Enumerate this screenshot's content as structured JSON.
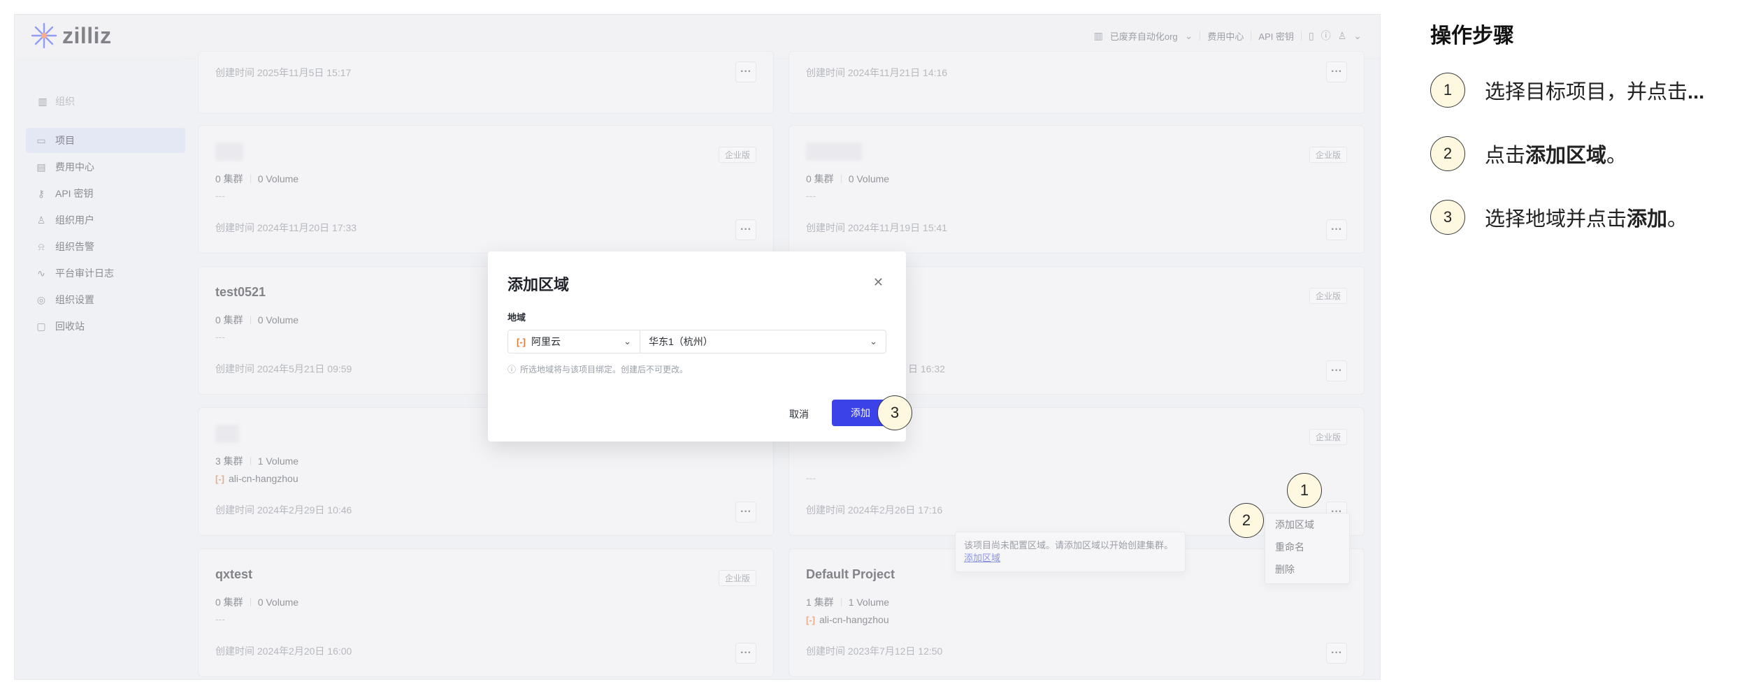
{
  "app": {
    "logo_text": "zilliz",
    "org_switcher": "已废弃自动化org",
    "billing_link": "费用中心",
    "api_key_link": "API 密钥"
  },
  "sidebar": {
    "org_label": "组织",
    "items": [
      {
        "label": "项目",
        "icon": "folder-icon",
        "active": true
      },
      {
        "label": "费用中心",
        "icon": "bill-icon"
      },
      {
        "label": "API 密钥",
        "icon": "key-icon"
      },
      {
        "label": "组织用户",
        "icon": "users-icon"
      },
      {
        "label": "组织告警",
        "icon": "alarm-icon"
      },
      {
        "label": "平台审计日志",
        "icon": "activity-icon"
      },
      {
        "label": "组织设置",
        "icon": "settings-icon"
      },
      {
        "label": "回收站",
        "icon": "trash-icon"
      }
    ]
  },
  "projects": {
    "tier_label": "企业版",
    "cards": [
      {
        "created": "创建时间 2025年11月5日 15:17"
      },
      {
        "created": "创建时间 2024年11月21日 14:16"
      },
      {
        "clusters": "0 集群",
        "volumes": "0 Volume",
        "region": "---",
        "created": "创建时间 2024年11月20日 17:33"
      },
      {
        "clusters": "0 集群",
        "volumes": "0 Volume",
        "region": "---",
        "created": "创建时间 2024年11月19日 15:41"
      },
      {
        "name": "test0521",
        "clusters": "0 集群",
        "volumes": "0 Volume",
        "region": "---",
        "created": "创建时间 2024年5月21日 09:59"
      },
      {
        "created": "日 16:32"
      },
      {
        "clusters": "3 集群",
        "volumes": "1 Volume",
        "region": "ali-cn-hangzhou",
        "created": "创建时间 2024年2月29日 10:46"
      },
      {
        "region": "---",
        "created": "创建时间 2024年2月26日 17:16"
      },
      {
        "name": "qxtest",
        "clusters": "0 集群",
        "volumes": "0 Volume",
        "region": "---",
        "created": "创建时间 2024年2月20日 16:00"
      },
      {
        "name": "Default Project",
        "clusters": "1 集群",
        "volumes": "1 Volume",
        "region": "ali-cn-hangzhou",
        "created": "创建时间 2023年7月12日 12:50"
      }
    ],
    "more_symbol": "···"
  },
  "context_menu": {
    "items": [
      "添加区域",
      "重命名",
      "删除"
    ]
  },
  "tooltip": {
    "text": "该项目尚未配置区域。请添加区域以开始创建集群。",
    "link": "添加区域"
  },
  "modal": {
    "title": "添加区域",
    "field_label": "地域",
    "provider": "阿里云",
    "region": "华东1（杭州）",
    "hint": "所选地域将与该项目绑定。创建后不可更改。",
    "cancel": "取消",
    "confirm": "添加"
  },
  "callouts": [
    "1",
    "2",
    "3"
  ],
  "guide": {
    "title": "操作步骤",
    "steps": [
      {
        "num": "1",
        "text": "选择目标项目，并点击",
        "bold": "..."
      },
      {
        "num": "2",
        "text": "点击",
        "bold": "添加区域",
        "suffix": "。"
      },
      {
        "num": "3",
        "text": "选择地域并点击",
        "bold": "添加",
        "suffix": "。"
      }
    ]
  }
}
